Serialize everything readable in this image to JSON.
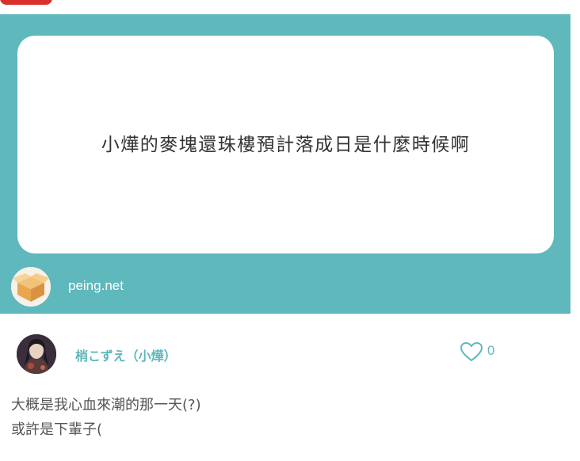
{
  "question": {
    "text": "小燁的麥塊還珠樓預計落成日是什麼時候啊"
  },
  "brand": {
    "domain": "peing.net",
    "logo_icon": "cardboard-box-icon"
  },
  "answer": {
    "user_name": "梢こずえ（小燁）",
    "avatar_icon": "user-avatar-icon",
    "like_icon": "heart-outline-icon",
    "like_count": "0",
    "lines": [
      "大概是我心血來潮的那一天(?)",
      "或許是下輩子("
    ]
  },
  "colors": {
    "teal": "#5fb8bc",
    "red_tab": "#d9302c",
    "card": "#ffffff",
    "text_dark": "#333333",
    "text_body": "#555555"
  }
}
